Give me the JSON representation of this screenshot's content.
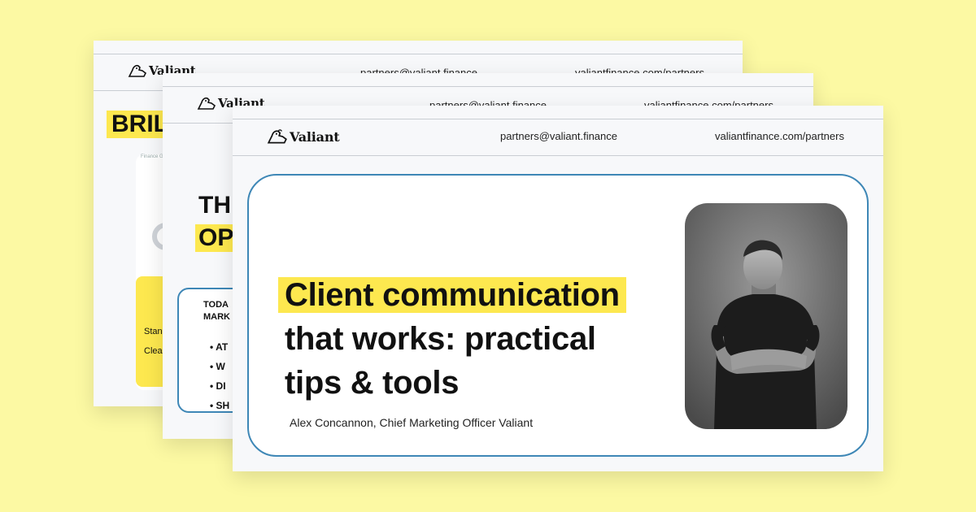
{
  "brand": {
    "name": "Valiant"
  },
  "header": {
    "email": "partners@valiant.finance",
    "url": "valiantfinance.com/partners"
  },
  "back_slide_1": {
    "heading_fragment": "BRIL",
    "mini_logo_text": "Finance Group",
    "line1": "Stan",
    "line2": "Clear"
  },
  "back_slide_2": {
    "heading_line1": "TH",
    "heading_line2": "OP",
    "box_label_line1": "TODA",
    "box_label_line2": "MARK",
    "bullets": [
      "AT",
      "W",
      "DI",
      "SH"
    ]
  },
  "main_slide": {
    "title_highlight": "Client communication",
    "title_line2": "that works: practical",
    "title_line3": "tips & tools",
    "subtitle": "Alex Concannon, Chief Marketing Officer Valiant",
    "photo_alt": "Portrait of Alex Concannon"
  },
  "colors": {
    "background": "#fcf9a3",
    "highlight": "#fde84f",
    "accent_border": "#3e87b6",
    "slide_bg": "#f7f8fa"
  }
}
